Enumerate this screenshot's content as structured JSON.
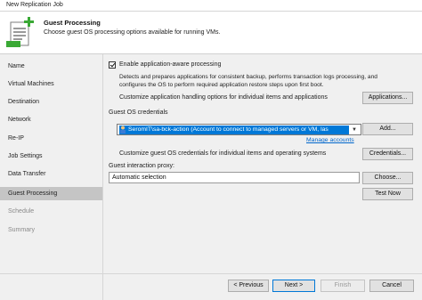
{
  "window": {
    "title": "New Replication Job"
  },
  "header": {
    "title": "Guest Processing",
    "subtitle": "Choose guest OS processing options available for running VMs."
  },
  "sidebar": {
    "items": [
      {
        "label": "Name"
      },
      {
        "label": "Virtual Machines"
      },
      {
        "label": "Destination"
      },
      {
        "label": "Network"
      },
      {
        "label": "Re-IP"
      },
      {
        "label": "Job Settings"
      },
      {
        "label": "Data Transfer"
      },
      {
        "label": "Guest Processing"
      },
      {
        "label": "Schedule"
      },
      {
        "label": "Summary"
      }
    ],
    "active_index": 7
  },
  "main": {
    "app_aware": {
      "checked": true,
      "label": "Enable application-aware processing",
      "description_line1": "Detects and prepares applications for consistent backup, performs transaction logs processing, and",
      "description_line2": "configures the OS to perform required application restore steps upon first boot.",
      "customize_label": "Customize application handling options for individual items and applications",
      "applications_button": "Applications..."
    },
    "credentials": {
      "section_label": "Guest OS credentials",
      "selected_value": "SeromIT\\sa-bck-action (Account to connect to managed servers or VM, las",
      "add_button": "Add...",
      "manage_link": "Manage accounts",
      "customize_label": "Customize guest OS credentials for individual items and operating systems",
      "credentials_button": "Credentials..."
    },
    "proxy": {
      "section_label": "Guest interaction proxy:",
      "value": "Automatic selection",
      "choose_button": "Choose...",
      "test_button": "Test Now"
    }
  },
  "footer": {
    "previous": "< Previous",
    "next": "Next >",
    "finish": "Finish",
    "cancel": "Cancel"
  },
  "colors": {
    "selection": "#0078d7",
    "sidebar_active": "#c5c5c5",
    "link": "#0066cc",
    "icon_green": "#3aa935"
  }
}
